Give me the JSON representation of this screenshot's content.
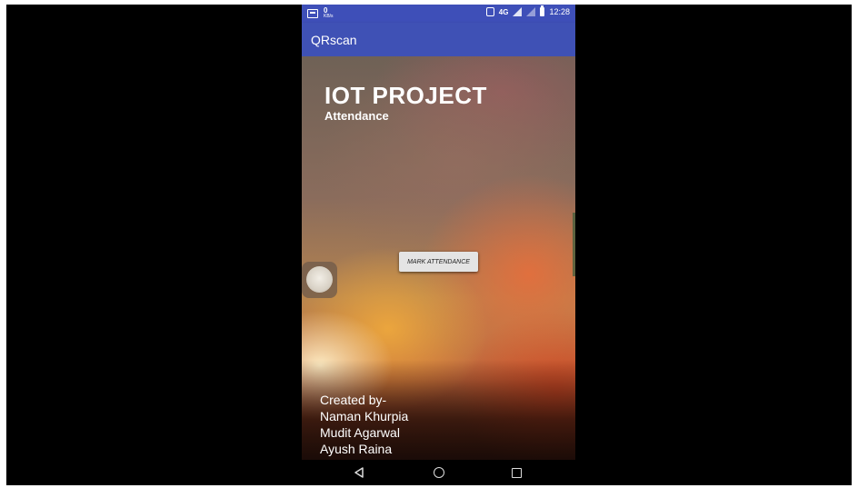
{
  "status_bar": {
    "speed_value": "0",
    "speed_unit": "KB/s",
    "network": "4G",
    "time": "12:28"
  },
  "app_bar": {
    "title": "QRscan"
  },
  "main": {
    "title": "IOT PROJECT",
    "subtitle": "Attendance",
    "mark_button_label": "MARK ATTENDANCE",
    "credits": [
      "Created by-",
      "Naman Khurpia",
      "Mudit Agarwal",
      "Ayush Raina"
    ]
  },
  "nav_bar": {
    "icons": [
      "back-icon",
      "home-icon",
      "recent-apps-icon"
    ]
  },
  "colors": {
    "app_bar": "#3f51b5",
    "status_bar": "#3e4fb8",
    "button_bg": "#e4e4e4"
  }
}
